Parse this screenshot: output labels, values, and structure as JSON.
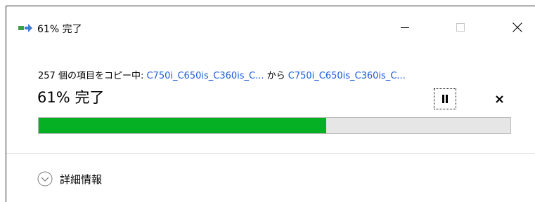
{
  "window": {
    "title": "61% 完了"
  },
  "title_controls": {
    "minimize": "minimize",
    "maximize": "maximize",
    "close": "close"
  },
  "status": {
    "prefix": "257 個の項目をコピー中: ",
    "source": "C750i_C650is_C360is_C...",
    "middle": " から ",
    "destination": "C750i_C650is_C360is_C..."
  },
  "percent_label": "61% 完了",
  "progress": {
    "fraction": 0.61
  },
  "details": {
    "label": "詳細情報"
  },
  "colors": {
    "progress_fill": "#06b025",
    "progress_track": "#e6e6e6",
    "link": "#1a5bd8"
  },
  "icons": {
    "app": "copy-progress-icon",
    "pause": "pause-icon",
    "cancel": "cancel-icon",
    "details": "chevron-down-circle-icon"
  }
}
